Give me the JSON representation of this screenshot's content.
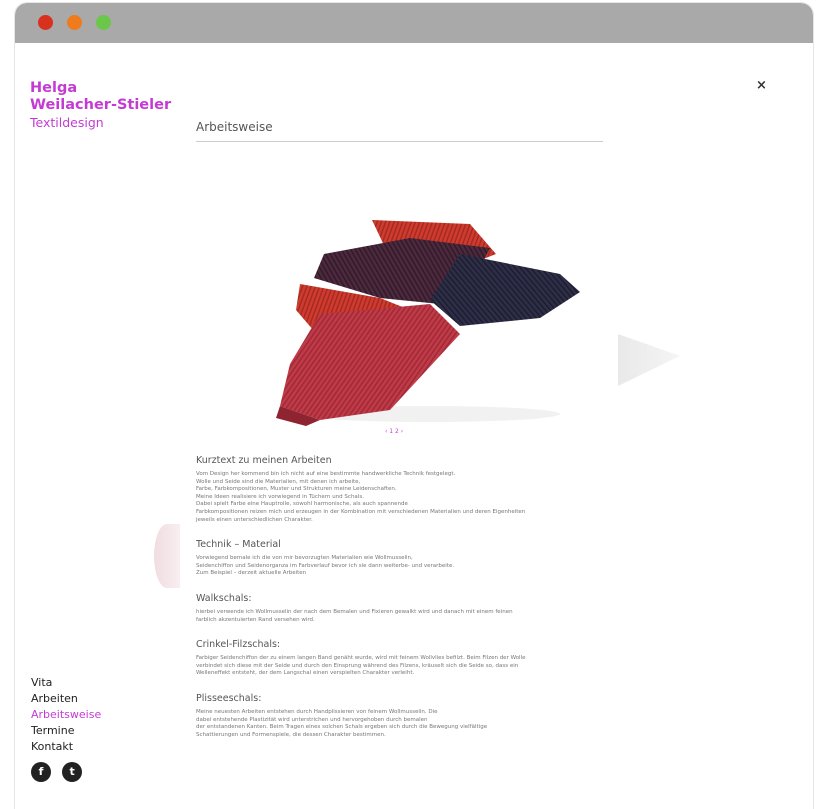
{
  "brand": {
    "name_line1": "Helga",
    "name_line2": "Weilacher-Stieler",
    "subtitle": "Textildesign"
  },
  "close_label": "×",
  "page": {
    "title": "Arbeitsweise"
  },
  "gallery": {
    "pager": "‹ 1 2 ›"
  },
  "sections": [
    {
      "heading": "Kurztext zu meinen Arbeiten",
      "lines": [
        "Vom Design her kommend bin ich nicht auf eine bestimmte handwerkliche Technik festgelegt.",
        "Wolle und Seide sind die Materialien, mit denen ich arbeite,",
        "Farbe, Farbkompositionen, Muster und Strukturen meine Leidenschaften.",
        "Meine Ideen realisiere ich vorwiegend in Tüchern und Schals.",
        "Dabei spielt Farbe eine Hauptrolle, sowohl harmonische, als auch spannende",
        "Farbkompositionen reizen mich und erzeugen in der Kombination mit verschiedenen Materialien und deren Eigenheiten",
        "jeweils einen unterschiedlichen Charakter."
      ]
    },
    {
      "heading": "Technik – Material",
      "lines": [
        "Vorwiegend bemale ich die von mir bevorzugten Materialien wie Wollmusselin,",
        "Seidenchiffon und Seidenorganza im Farbverlauf bevor ich sie dann weiterbe- und verarbeite.",
        "Zum Beispiel – derzeit aktuelle Arbeiten"
      ]
    },
    {
      "heading": "Walkschals:",
      "lines": [
        "hierbei verwende ich Wollmusselin der nach dem Bemalen und Fixieren gewalkt wird und danach mit einem feinen",
        "farblich akzentuierten Rand versehen wird."
      ]
    },
    {
      "heading": "Crinkel-Filzschals:",
      "lines": [
        "Farbiger Seidenchiffon der zu einem langen Band genäht wurde, wird mit feinem Wollvlies befilzt. Beim Filzen der Wolle",
        "verbindet sich diese mit der Seide und durch den Einsprung während des Filzens, kräuselt sich die Seide so, dass ein",
        "Welleneffekt entsteht, der dem Langschal einen verspielten Charakter verleiht."
      ]
    },
    {
      "heading": "Plisseeschals:",
      "lines": [
        "Meine neuesten Arbeiten entstehen durch Handplissieren von feinem Wollmusselin. Die",
        "dabei entstehende Plastizität wird unterstrichen und hervorgehoben durch bemalen",
        "der entstandenen Kanten. Beim Tragen eines solchen Schals ergeben sich durch die Bewegung vielfältige",
        "Schattierungen und Formenspiele, die dessen Charakter bestimmen."
      ]
    }
  ],
  "nav": {
    "items": [
      "Vita",
      "Arbeiten",
      "Arbeitsweise",
      "Termine",
      "Kontakt"
    ],
    "active": "Arbeitsweise"
  },
  "social": {
    "facebook": "f",
    "twitter": "t"
  },
  "colors": {
    "accent": "#c43bd4",
    "titlebar": "#a9a9a9",
    "dot_red": "#d8311e",
    "dot_orange": "#ee7b1c",
    "dot_green": "#6ac74a"
  }
}
